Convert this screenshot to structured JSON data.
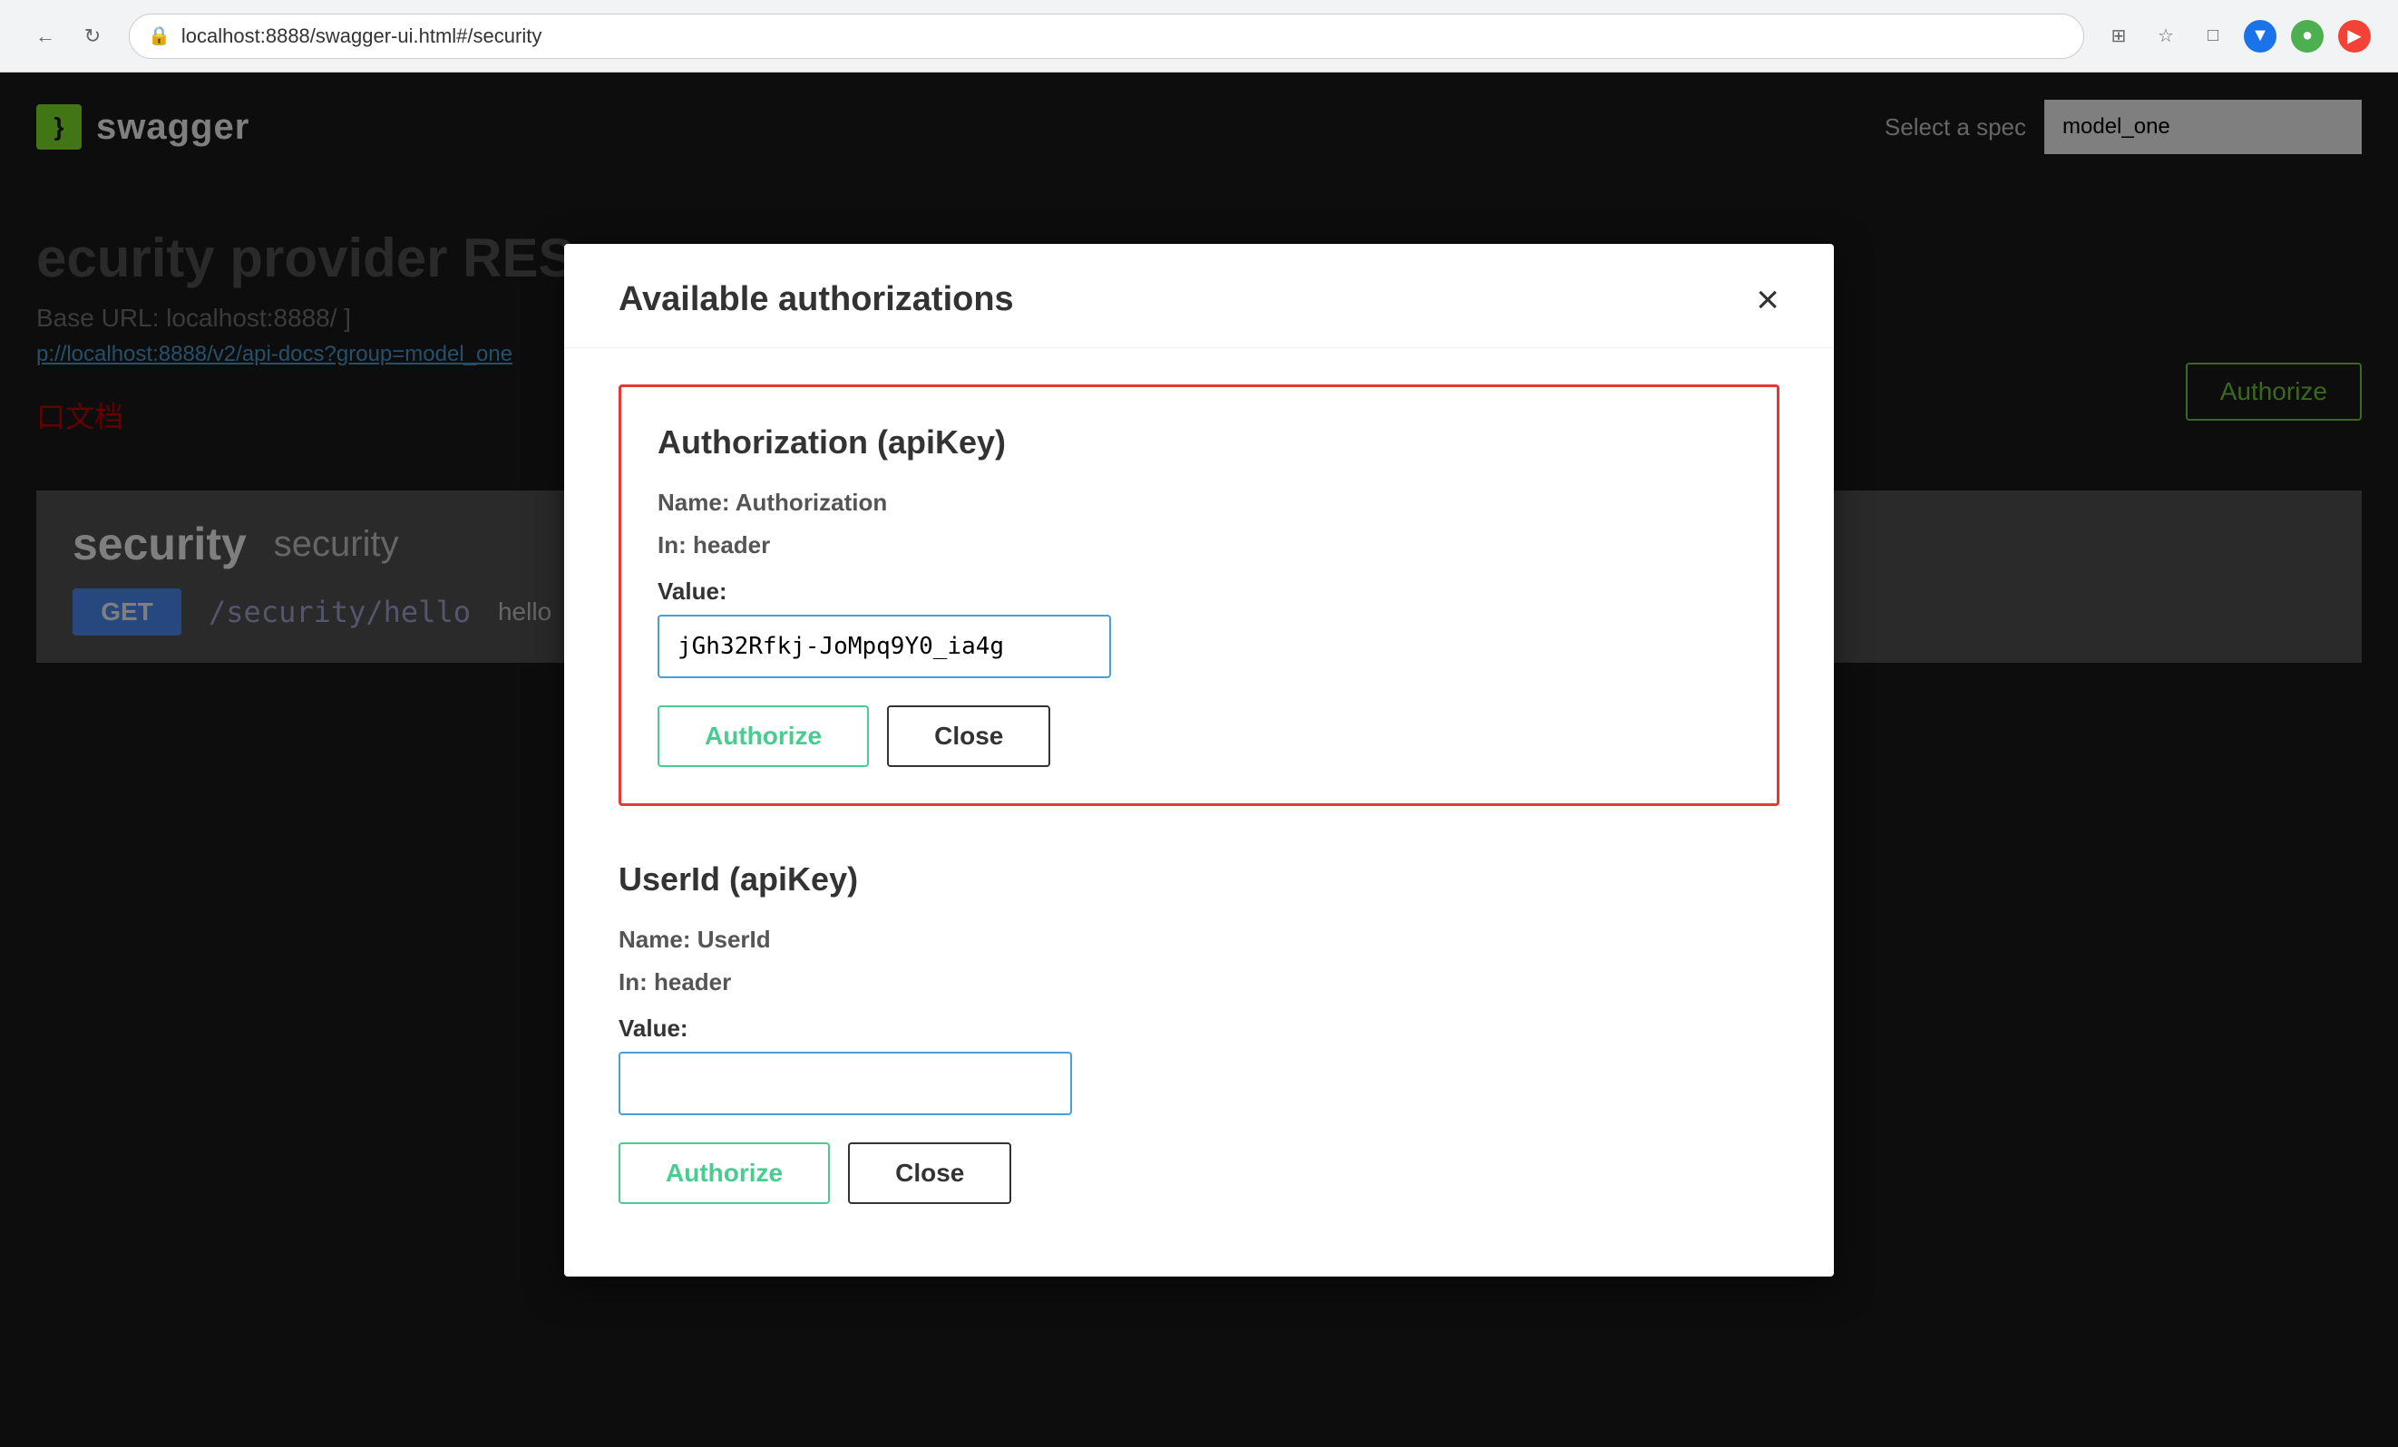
{
  "browser": {
    "url": "localhost:8888/swagger-ui.html#/security",
    "back_label": "←",
    "refresh_label": "↻"
  },
  "swagger": {
    "logo_text": "}",
    "brand": "swagger",
    "spec_label": "Select a spec",
    "spec_value": "model_one"
  },
  "page": {
    "title": "ecurity provider RES",
    "base_url_label": "Base URL: localhost:8888/ ]",
    "link_text": "p://localhost:8888/v2/api-docs?group=model_one",
    "chinese_text": "口文档"
  },
  "security": {
    "bold_label": "security",
    "light_label": "security",
    "endpoint": {
      "method": "GET",
      "path": "/security/hello",
      "description": "hello"
    }
  },
  "authorize_top_btn": "Authorize",
  "modal": {
    "title": "Available authorizations",
    "close_label": "×",
    "auth1": {
      "title": "Authorization (apiKey)",
      "name_label": "Name:",
      "name_value": "Authorization",
      "in_label": "In:",
      "in_value": "header",
      "value_label": "Value:",
      "input_value": "jGh32Rfkj-JoMpq9Y0_ia4g",
      "authorize_btn": "Authorize",
      "close_btn": "Close"
    },
    "auth2": {
      "title": "UserId (apiKey)",
      "name_label": "Name:",
      "name_value": "UserId",
      "in_label": "In:",
      "in_value": "header",
      "value_label": "Value:",
      "input_value": "",
      "input_placeholder": "",
      "authorize_btn": "Authorize",
      "close_btn": "Close"
    }
  }
}
